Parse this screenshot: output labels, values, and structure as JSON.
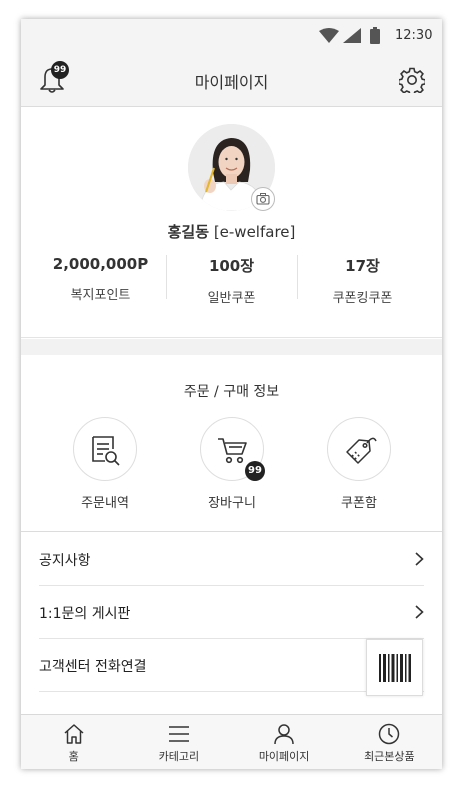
{
  "status_bar": {
    "time": "12:30"
  },
  "header": {
    "title": "마이페이지",
    "notification_count": "99"
  },
  "profile": {
    "name": "홍길동",
    "site": "[e-welfare]",
    "stats": [
      {
        "value": "2,000,000P",
        "label": "복지포인트"
      },
      {
        "value": "100장",
        "label": "일반쿠폰"
      },
      {
        "value": "17장",
        "label": "쿠폰킹쿠폰"
      }
    ]
  },
  "orders": {
    "title": "주문 / 구매 정보",
    "items": [
      {
        "label": "주문내역",
        "icon": "order-history-icon"
      },
      {
        "label": "장바구니",
        "icon": "cart-icon",
        "badge": "99"
      },
      {
        "label": "쿠폰함",
        "icon": "coupon-tag-icon"
      }
    ]
  },
  "menu": [
    {
      "label": "공지사항"
    },
    {
      "label": "1:1문의 게시판"
    },
    {
      "label": "고객센터 전화연결"
    }
  ],
  "bottom_nav": [
    {
      "label": "홈",
      "icon": "home-icon"
    },
    {
      "label": "카테고리",
      "icon": "menu-icon"
    },
    {
      "label": "마이페이지",
      "icon": "person-icon"
    },
    {
      "label": "최근본상품",
      "icon": "clock-icon"
    }
  ],
  "colors": {
    "badge": "#222222",
    "background": "#f4f4f4",
    "divider": "#e4e4e4"
  }
}
